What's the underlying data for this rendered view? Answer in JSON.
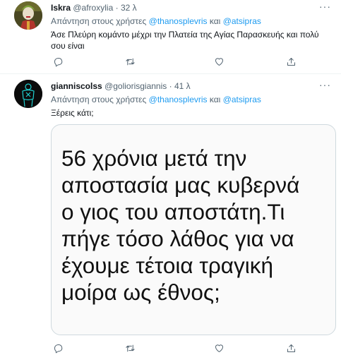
{
  "tweets": [
    {
      "name": "Iskra",
      "handle": "@afroxylia",
      "separator": "·",
      "time": "32 λ",
      "reply_prefix": "Απάντηση στους χρήστες",
      "reply_user1": "@thanosplevris",
      "reply_and": "και",
      "reply_user2": "@atsipras",
      "text": "Άσε Πλεύρη κομάντο μέχρι την Πλατεία της Αγίας Παρασκευής και πολύ σου είναι",
      "more_label": "···",
      "icons": [
        "more-icon",
        "reply-icon",
        "retweet-icon",
        "like-icon",
        "share-icon"
      ]
    },
    {
      "name": "gianniscolss",
      "handle": "@goliorisgiannis",
      "separator": "·",
      "time": "41 λ",
      "reply_prefix": "Απάντηση στους χρήστες",
      "reply_user1": "@thanosplevris",
      "reply_and": "και",
      "reply_user2": "@atsipras",
      "text": "Ξέρεις κάτι;",
      "more_label": "···",
      "media_lines": [
        "56 χρόνια μετά την",
        "αποστασία μας κυβερνά",
        "ο γιος του αποστάτη.Τι",
        "πήγε τόσο λάθος για να",
        "έχουμε τέτοια τραγική",
        "μοίρα ως έθνος;"
      ],
      "icons": [
        "more-icon",
        "reply-icon",
        "retweet-icon",
        "like-icon",
        "share-icon"
      ]
    }
  ],
  "colors": {
    "text": "#0f1419",
    "secondary": "#536471",
    "accent": "#1d9bf0",
    "divider": "#eff3f4"
  }
}
